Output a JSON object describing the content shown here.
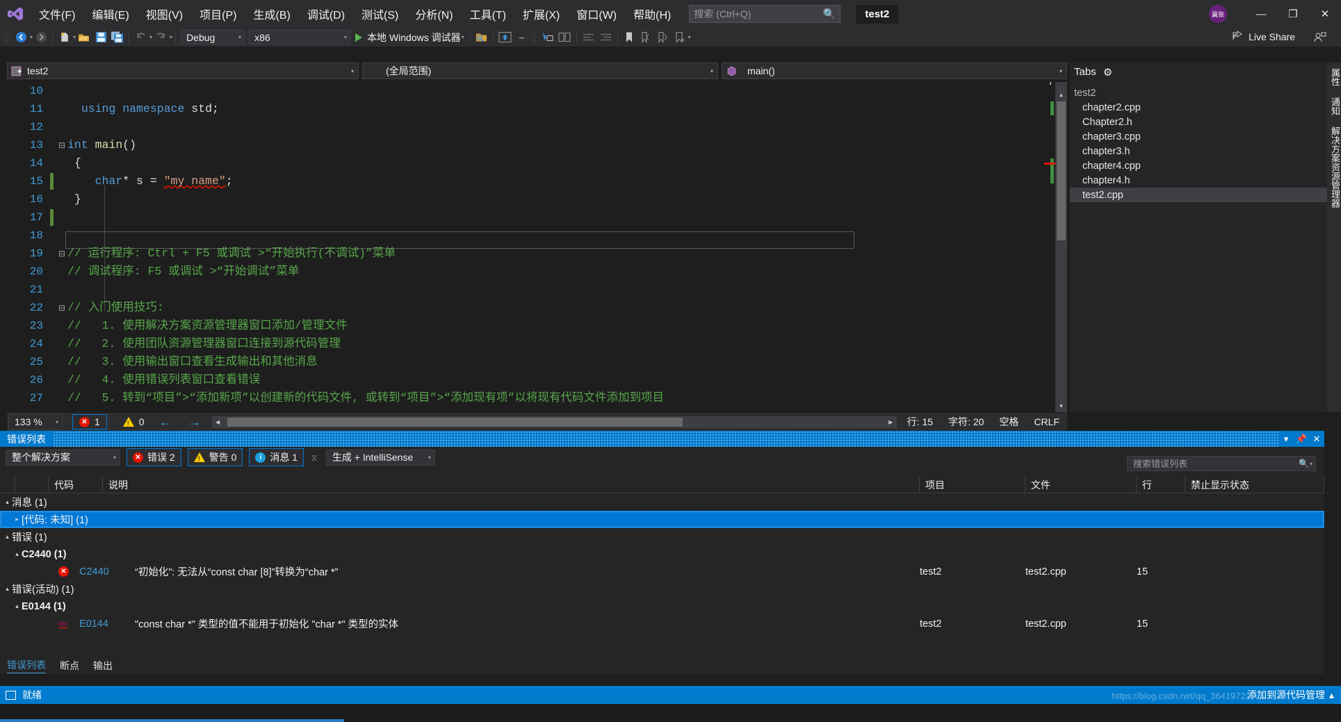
{
  "app": {
    "title": "test2",
    "logo_icon": "visual-studio-logo"
  },
  "menu": {
    "items": [
      {
        "label": "文件(F)"
      },
      {
        "label": "编辑(E)"
      },
      {
        "label": "视图(V)"
      },
      {
        "label": "项目(P)"
      },
      {
        "label": "生成(B)"
      },
      {
        "label": "调试(D)"
      },
      {
        "label": "测试(S)"
      },
      {
        "label": "分析(N)"
      },
      {
        "label": "工具(T)"
      },
      {
        "label": "扩展(X)"
      },
      {
        "label": "窗口(W)"
      },
      {
        "label": "帮助(H)"
      }
    ],
    "search_placeholder": "搜索 (Ctrl+Q)",
    "search_value": "",
    "search_icon": "search-icon",
    "project_chip": "test2"
  },
  "window_controls": {
    "avatar_initials": "冀张",
    "minimize": "—",
    "restore": "❐",
    "close": "✕"
  },
  "toolbar": {
    "back_icon": "navigate-back-icon",
    "forward_icon": "navigate-forward-icon",
    "new_file_icon": "new-file-icon",
    "open_file_icon": "open-file-icon",
    "save_icon": "save-icon",
    "save_all_icon": "save-all-icon",
    "undo_icon": "undo-icon",
    "redo_icon": "redo-icon",
    "config_combo": "Debug",
    "platform_combo": "x86",
    "run_label": "本地 Windows 调试器",
    "run_icon": "play-icon",
    "live_share_label": "Live Share",
    "live_share_icon": "live-share-icon",
    "invite_icon": "invite-user-icon"
  },
  "navbars": {
    "project": "test2",
    "project_icon": "project-icon",
    "scope": "(全局范围)",
    "member": "main()",
    "member_icon": "method-icon"
  },
  "editor": {
    "lines": [
      {
        "num": "10",
        "fold": "",
        "marker": "",
        "segments": [
          {
            "t": "",
            "c": "pln"
          }
        ]
      },
      {
        "num": "11",
        "fold": "",
        "marker": "",
        "segments": [
          {
            "t": "  ",
            "c": "pln"
          },
          {
            "t": "using",
            "c": "kw"
          },
          {
            "t": " ",
            "c": "pln"
          },
          {
            "t": "namespace",
            "c": "kw"
          },
          {
            "t": " std;",
            "c": "pln"
          }
        ]
      },
      {
        "num": "12",
        "fold": "",
        "marker": "",
        "segments": [
          {
            "t": "",
            "c": "pln"
          }
        ]
      },
      {
        "num": "13",
        "fold": "−",
        "marker": "",
        "segments": [
          {
            "t": "int",
            "c": "kw"
          },
          {
            "t": " ",
            "c": "pln"
          },
          {
            "t": "main",
            "c": "fn"
          },
          {
            "t": "()",
            "c": "pln"
          }
        ]
      },
      {
        "num": "14",
        "fold": "",
        "marker": "",
        "segments": [
          {
            "t": " {",
            "c": "pln"
          }
        ]
      },
      {
        "num": "15",
        "fold": "",
        "marker": "green",
        "segments": [
          {
            "t": "    ",
            "c": "pln"
          },
          {
            "t": "char",
            "c": "kw"
          },
          {
            "t": "* s = ",
            "c": "pln"
          },
          {
            "t": "\"my name\"",
            "c": "str squig"
          },
          {
            "t": ";",
            "c": "pln"
          }
        ]
      },
      {
        "num": "16",
        "fold": "",
        "marker": "",
        "segments": [
          {
            "t": " }",
            "c": "pln"
          }
        ]
      },
      {
        "num": "17",
        "fold": "",
        "marker": "green",
        "segments": [
          {
            "t": "",
            "c": "pln"
          }
        ]
      },
      {
        "num": "18",
        "fold": "",
        "marker": "",
        "segments": [
          {
            "t": "",
            "c": "pln"
          }
        ]
      },
      {
        "num": "19",
        "fold": "−",
        "marker": "",
        "segments": [
          {
            "t": "// 运行程序: Ctrl + F5 或调试 >“开始执行(不调试)”菜单",
            "c": "cmt"
          }
        ]
      },
      {
        "num": "20",
        "fold": "",
        "marker": "",
        "segments": [
          {
            "t": "// 调试程序: F5 或调试 >“开始调试”菜单",
            "c": "cmt"
          }
        ]
      },
      {
        "num": "21",
        "fold": "",
        "marker": "",
        "segments": [
          {
            "t": "",
            "c": "pln"
          }
        ]
      },
      {
        "num": "22",
        "fold": "−",
        "marker": "",
        "segments": [
          {
            "t": "// 入门使用技巧: ",
            "c": "cmt"
          }
        ]
      },
      {
        "num": "23",
        "fold": "",
        "marker": "",
        "segments": [
          {
            "t": "//   1. 使用解决方案资源管理器窗口添加/管理文件",
            "c": "cmt"
          }
        ]
      },
      {
        "num": "24",
        "fold": "",
        "marker": "",
        "segments": [
          {
            "t": "//   2. 使用团队资源管理器窗口连接到源代码管理",
            "c": "cmt"
          }
        ]
      },
      {
        "num": "25",
        "fold": "",
        "marker": "",
        "segments": [
          {
            "t": "//   3. 使用输出窗口查看生成输出和其他消息",
            "c": "cmt"
          }
        ]
      },
      {
        "num": "26",
        "fold": "",
        "marker": "",
        "segments": [
          {
            "t": "//   4. 使用错误列表窗口查看错误",
            "c": "cmt"
          }
        ]
      },
      {
        "num": "27",
        "fold": "",
        "marker": "",
        "segments": [
          {
            "t": "//   5. 转到“项目”>“添加新项”以创建新的代码文件, 或转到“项目”>“添加现有项”以将现有代码文件添加到项目",
            "c": "cmt"
          }
        ]
      }
    ]
  },
  "editor_status": {
    "zoom": "133 %",
    "error_count": "1",
    "warning_count": "0",
    "prev_icon": "arrow-left-icon",
    "next_icon": "arrow-right-icon",
    "line_label": "行: 15",
    "char_label": "字符: 20",
    "indent_label": "空格",
    "eol_label": "CRLF"
  },
  "tabs_panel": {
    "title": "Tabs",
    "settings_icon": "gear-icon",
    "items": [
      {
        "label": "test2",
        "level": "root",
        "active": false
      },
      {
        "label": "chapter2.cpp",
        "level": "child",
        "active": false
      },
      {
        "label": "Chapter2.h",
        "level": "child",
        "active": false
      },
      {
        "label": "chapter3.cpp",
        "level": "child",
        "active": false
      },
      {
        "label": "chapter3.h",
        "level": "child",
        "active": false
      },
      {
        "label": "chapter4.cpp",
        "level": "child",
        "active": false
      },
      {
        "label": "chapter4.h",
        "level": "child",
        "active": false
      },
      {
        "label": "test2.cpp",
        "level": "child",
        "active": true
      }
    ]
  },
  "side_labels": {
    "items": [
      "属性",
      "通知",
      "解决方案资源管理器"
    ]
  },
  "error_list": {
    "title": "错误列表",
    "pin_icon": "pin-icon",
    "close_icon": "close-icon",
    "dropdown_icon": "chevron-down-icon",
    "scope_filter": "整个解决方案",
    "errors_chip": "错误 2",
    "warnings_chip": "警告 0",
    "messages_chip": "消息 1",
    "filter_icon": "clear-filter-icon",
    "build_filter": "生成 + IntelliSense",
    "search_placeholder": "搜索错误列表",
    "search_value": "",
    "search_icon": "search-icon",
    "columns": [
      "",
      "",
      "代码",
      "说明",
      "项目",
      "文件",
      "行",
      "禁止显示状态"
    ],
    "rows": [
      {
        "type": "group",
        "indent": 0,
        "tri": "▴",
        "label": "消息 (1)",
        "selected": false
      },
      {
        "type": "group",
        "indent": 1,
        "tri": "▸",
        "label": "[代码: 未知] (1)",
        "selected": true
      },
      {
        "type": "group",
        "indent": 0,
        "tri": "▴",
        "label": "错误 (1)",
        "selected": false
      },
      {
        "type": "group",
        "indent": 1,
        "tri": "▴",
        "label": "C2440 (1)",
        "selected": false
      },
      {
        "type": "item",
        "indent": 2,
        "icon": "error-icon",
        "code": "C2440",
        "description": "“初始化”: 无法从“const char [8]”转换为“char *”",
        "project": "test2",
        "file": "test2.cpp",
        "line": "15",
        "suppression": ""
      },
      {
        "type": "group",
        "indent": 0,
        "tri": "▴",
        "label": "错误(活动) (1)",
        "selected": false
      },
      {
        "type": "group",
        "indent": 1,
        "tri": "▴",
        "label": "E0144 (1)",
        "selected": false
      },
      {
        "type": "item",
        "indent": 2,
        "icon": "intellisense-error-icon",
        "code": "E0144",
        "description": "\"const char *\" 类型的值不能用于初始化 \"char *\" 类型的实体",
        "project": "test2",
        "file": "test2.cpp",
        "line": "15",
        "suppression": ""
      }
    ],
    "bottom_tabs": [
      {
        "label": "错误列表",
        "active": true
      },
      {
        "label": "断点",
        "active": false
      },
      {
        "label": "输出",
        "active": false
      }
    ]
  },
  "status_bar": {
    "ready_label": "就绪",
    "ready_icon": "ready-icon",
    "add_to_source_control": "添加到源代码管理",
    "watermark": "https://blog.csdn.net/qq_36419722",
    "arrow_icon": "chevron-up-icon"
  },
  "colors": {
    "accent": "#007acc",
    "error": "#e51400",
    "warning": "#ffcc00",
    "info": "#1ba1e2",
    "comment": "#57a64a",
    "keyword": "#569cd6",
    "string": "#d69d85",
    "chrome": "#2d2d30",
    "editor_bg": "#1e1e1e"
  }
}
